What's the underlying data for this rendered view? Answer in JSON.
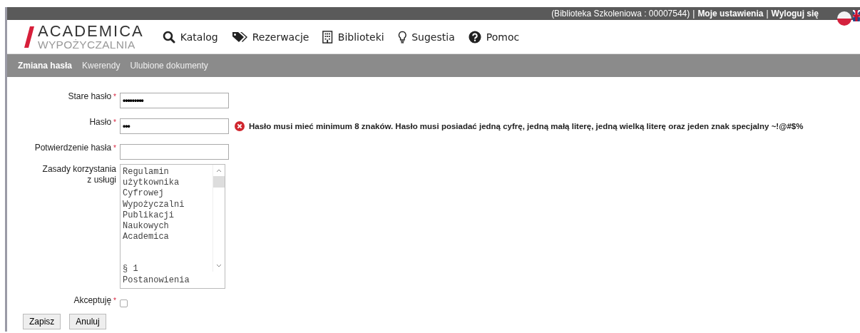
{
  "top_bar": {
    "items": [
      {
        "kind": "text",
        "label": "(Biblioteka Szkoleniowa : 00007544)"
      },
      {
        "kind": "sep",
        "label": "|"
      },
      {
        "kind": "link",
        "label": "Moje ustawienia"
      },
      {
        "kind": "sep",
        "label": "|"
      },
      {
        "kind": "link",
        "label": "Wyloguj się"
      }
    ],
    "languages": [
      {
        "kind": "pl"
      },
      {
        "kind": "en"
      }
    ]
  },
  "logo": {
    "title": "ACADEMICA",
    "subtitle": "WYPOŻYCZALNIA"
  },
  "main_nav": [
    {
      "label": "Katalog",
      "kind": "search"
    },
    {
      "label": "Rezerwacje",
      "kind": "tags"
    },
    {
      "label": "Biblioteki",
      "kind": "building"
    },
    {
      "label": "Sugestia",
      "kind": "bulb"
    },
    {
      "label": "Pomoc",
      "kind": "help"
    }
  ],
  "sub_nav": [
    {
      "label": "Zmiana hasła",
      "selected": true
    },
    {
      "label": "Kwerendy",
      "selected": false
    },
    {
      "label": "Ulubione dokumenty",
      "selected": false
    }
  ],
  "form": {
    "fields": [
      {
        "kind": "password",
        "label": "Stare hasło",
        "required_mark": "*",
        "value": "•••••••••"
      },
      {
        "kind": "password",
        "label": "Hasło",
        "required_mark": "*",
        "value": "•••",
        "error": "Hasło musi mieć minimum 8 znaków. Hasło musi posiadać jedną cyfrę, jedną małą literę, jedną wielką literę oraz jeden znak specjalny ~!@#$%"
      },
      {
        "kind": "password",
        "label": "Potwierdzenie hasła",
        "required_mark": "*"
      },
      {
        "kind": "textarea",
        "label": "Zasady korzystania z usługi",
        "paragraphs": [
          {
            "lines": [
              "Regulamin",
              "użytkownika",
              "Cyfrowej",
              "Wypożyczalni",
              "Publikacji",
              "Naukowych",
              "Academica"
            ]
          },
          {
            "lines": [
              "§ 1",
              "Postanowienia"
            ]
          }
        ]
      },
      {
        "kind": "checkbox",
        "label": "Akceptuję",
        "required_mark": "*",
        "checked": false
      }
    ],
    "buttons": [
      {
        "label": "Zapisz"
      },
      {
        "label": "Anuluj"
      }
    ]
  }
}
